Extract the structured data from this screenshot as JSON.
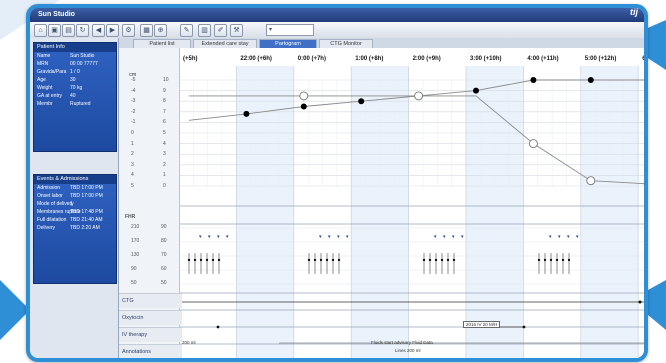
{
  "app": {
    "title": "Sun Studio",
    "subtitle": "",
    "brand_name": "tij",
    "brand_top": ""
  },
  "tabs": [
    {
      "label": "Patient list",
      "active": false
    },
    {
      "label": "Extended care stay",
      "active": false
    },
    {
      "label": "Partogram",
      "active": true
    },
    {
      "label": "CTG Monitor",
      "active": false
    }
  ],
  "patient_panel": {
    "header": "Patient Info",
    "rows": [
      {
        "k": "Name",
        "v": "Sun Studio"
      },
      {
        "k": "MRN",
        "v": "00 00 77777"
      },
      {
        "k": "Gravida/Para",
        "v": "1 / 0"
      },
      {
        "k": "Age",
        "v": "30"
      },
      {
        "k": "Weight",
        "v": "70 kg"
      },
      {
        "k": "GA at entry",
        "v": "40"
      },
      {
        "k": "Membr",
        "v": "Ruptured"
      }
    ]
  },
  "events_panel": {
    "header": "Events & Admissions",
    "rows": [
      {
        "k": "Admission",
        "v": "TBD 17:00 PM"
      },
      {
        "k": "Onset labor",
        "v": "TBD 17:00 PM"
      },
      {
        "k": "Mode of delivery",
        "v": "1"
      },
      {
        "k": "Membranes rupture",
        "v": "TBD 17:48 PM"
      },
      {
        "k": "Full dilatation",
        "v": "TBD 21:40 AM"
      },
      {
        "k": "Delivery",
        "v": "TBD 2:20 AM"
      }
    ]
  },
  "time_headers": [
    "(+5h)",
    "22:00 (+6h)",
    "0:00 (+7h)",
    "1:00 (+8h)",
    "2:00 (+9h)",
    "3:00 (+10h)",
    "4:00 (+11h)",
    "5:00 (+12h)",
    "6:0"
  ],
  "section_labels": {
    "cervix_head": "cm",
    "fhr": "FHR",
    "ctg": "CTG",
    "oxytocin": "Oxytocin",
    "iv": "IV therapy",
    "ann": "Annotations"
  },
  "cervix_ticks": [
    "10",
    "9",
    "8",
    "7",
    "6",
    "5",
    "4",
    "3",
    "2",
    "1",
    "0"
  ],
  "head_ticks": [
    "-5",
    "-4",
    "-3",
    "-2",
    "-1",
    "0",
    "1",
    "2",
    "3",
    "4",
    "5"
  ],
  "fhr_ticks": [
    "210",
    "170",
    "130",
    "90",
    "50"
  ],
  "bp_ticks": [
    "90",
    "80",
    "70",
    "60",
    "50"
  ],
  "annotations": {
    "drug_label": "2016 IV 20 M/H",
    "ann1": "Fluids start advisory Fluid Data",
    "ann2": "Lines 200 ml",
    "left_val": "200 ml"
  },
  "chart_data": {
    "type": "line",
    "x": [
      0,
      1,
      2,
      3,
      4,
      5,
      6,
      7,
      8
    ],
    "series": [
      {
        "values": [
          6.2,
          6.8,
          7.5,
          8.0,
          8.5,
          9.0,
          10.0,
          10.0,
          10.0
        ]
      },
      {
        "values": [
          8.5,
          8.5,
          8.5,
          8.5,
          8.5,
          8.5,
          4.0,
          0.5,
          0.2
        ]
      }
    ],
    "ylim": [
      0,
      10
    ]
  }
}
